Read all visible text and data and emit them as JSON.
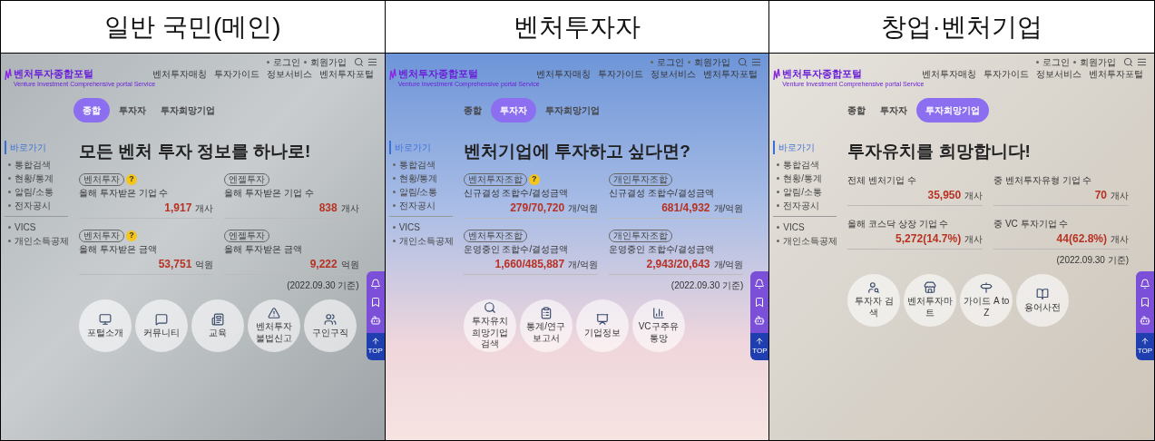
{
  "columns": [
    {
      "heading": "일반 국민(메인)",
      "portal": {
        "logo": "벤처투자종합포털",
        "logo_subtitle": "Venture Investment Comprehensive portal Service",
        "nav": [
          "벤처투자매칭",
          "투자가이드",
          "정보서비스",
          "벤처투자포털"
        ],
        "utility_links": [
          "로그인",
          "회원가입"
        ],
        "tabs": [
          {
            "label": "종합",
            "selected": true
          },
          {
            "label": "투자자",
            "selected": false
          },
          {
            "label": "투자희망기업",
            "selected": false
          }
        ],
        "sidebar": {
          "title": "바로가기",
          "groups": [
            [
              "통합검색",
              "현황/통계",
              "알림/소통",
              "전자공시"
            ],
            [
              "VICS",
              "개인소득공제"
            ]
          ]
        },
        "headline": "모든 벤처 투자 정보를 하나로!",
        "stats": [
          {
            "badge": "벤처투자",
            "help": "?",
            "label": "올해 투자받은 기업 수",
            "value": "1,917",
            "unit": "개사"
          },
          {
            "badge": "엔젤투자",
            "label": "올해 투자받은 기업 수",
            "value": "838",
            "unit": "개사"
          },
          {
            "badge": "벤처투자",
            "help": "?",
            "label": "올해 투자받은 금액",
            "value": "53,751",
            "unit": "억원"
          },
          {
            "badge": "엔젤투자",
            "label": "올해 투자받은 금액",
            "value": "9,222",
            "unit": "억원"
          }
        ],
        "date_note": "(2022.09.30 기준)",
        "shortcuts": [
          "포털소개",
          "커뮤니티",
          "교육",
          "벤처투자 불법신고",
          "구인구직"
        ],
        "top_label": "TOP"
      }
    },
    {
      "heading": "벤처투자자",
      "portal": {
        "logo": "벤처투자종합포털",
        "logo_subtitle": "Venture Investment Comprehensive portal Service",
        "nav": [
          "벤처투자매칭",
          "투자가이드",
          "정보서비스",
          "벤처투자포털"
        ],
        "utility_links": [
          "로그인",
          "회원가입"
        ],
        "tabs": [
          {
            "label": "종합",
            "selected": false
          },
          {
            "label": "투자자",
            "selected": true
          },
          {
            "label": "투자희망기업",
            "selected": false
          }
        ],
        "sidebar": {
          "title": "바로가기",
          "groups": [
            [
              "통합검색",
              "현황/통계",
              "알림/소통",
              "전자공시"
            ],
            [
              "VICS",
              "개인소득공제"
            ]
          ]
        },
        "headline": "벤처기업에 투자하고 싶다면?",
        "stats": [
          {
            "badge": "벤처투자조합",
            "help": "?",
            "label": "신규결성 조합수/결성금액",
            "value": "279/70,720",
            "unit": "개/억원"
          },
          {
            "badge": "개인투자조합",
            "label": "신규결성 조합수/결성금액",
            "value": "681/4,932",
            "unit": "개/억원"
          },
          {
            "badge": "벤처투자조합",
            "label": "운영중인 조합수/결성금액",
            "value": "1,660/485,887",
            "unit": "개/억원"
          },
          {
            "badge": "개인투자조합",
            "label": "운영중인 조합수/결성금액",
            "value": "2,943/20,643",
            "unit": "개/억원"
          }
        ],
        "date_note": "(2022.09.30 기준)",
        "shortcuts": [
          "투자유치 희망기업 검색",
          "통계/연구 보고서",
          "기업정보",
          "VC구주유통망"
        ],
        "top_label": "TOP"
      }
    },
    {
      "heading": "창업·벤처기업",
      "portal": {
        "logo": "벤처투자종합포털",
        "logo_subtitle": "Venture Investment Comprehensive portal Service",
        "nav": [
          "벤처투자매칭",
          "투자가이드",
          "정보서비스",
          "벤처투자포털"
        ],
        "utility_links": [
          "로그인",
          "회원가입"
        ],
        "tabs": [
          {
            "label": "종합",
            "selected": false
          },
          {
            "label": "투자자",
            "selected": false
          },
          {
            "label": "투자희망기업",
            "selected": true
          }
        ],
        "sidebar": {
          "title": "바로가기",
          "groups": [
            [
              "통합검색",
              "현황/통계",
              "알림/소통",
              "전자공시"
            ],
            [
              "VICS",
              "개인소득공제"
            ]
          ]
        },
        "headline": "투자유치를 희망합니다!",
        "stats": [
          {
            "label": "전체 벤처기업 수",
            "value": "35,950",
            "unit": "개사"
          },
          {
            "label": "중 벤처투자유형 기업 수",
            "value": "70",
            "unit": "개사"
          },
          {
            "label": "올해 코스닥 상장 기업 수",
            "value": "5,272(14.7%)",
            "unit": "개사"
          },
          {
            "label": "중 VC 투자기업 수",
            "value": "44(62.8%)",
            "unit": "개사"
          }
        ],
        "date_note": "(2022.09.30 기준)",
        "shortcuts": [
          "투자자 검색",
          "벤처투자마트",
          "가이드 A to Z",
          "용어사전"
        ],
        "top_label": "TOP"
      }
    }
  ]
}
